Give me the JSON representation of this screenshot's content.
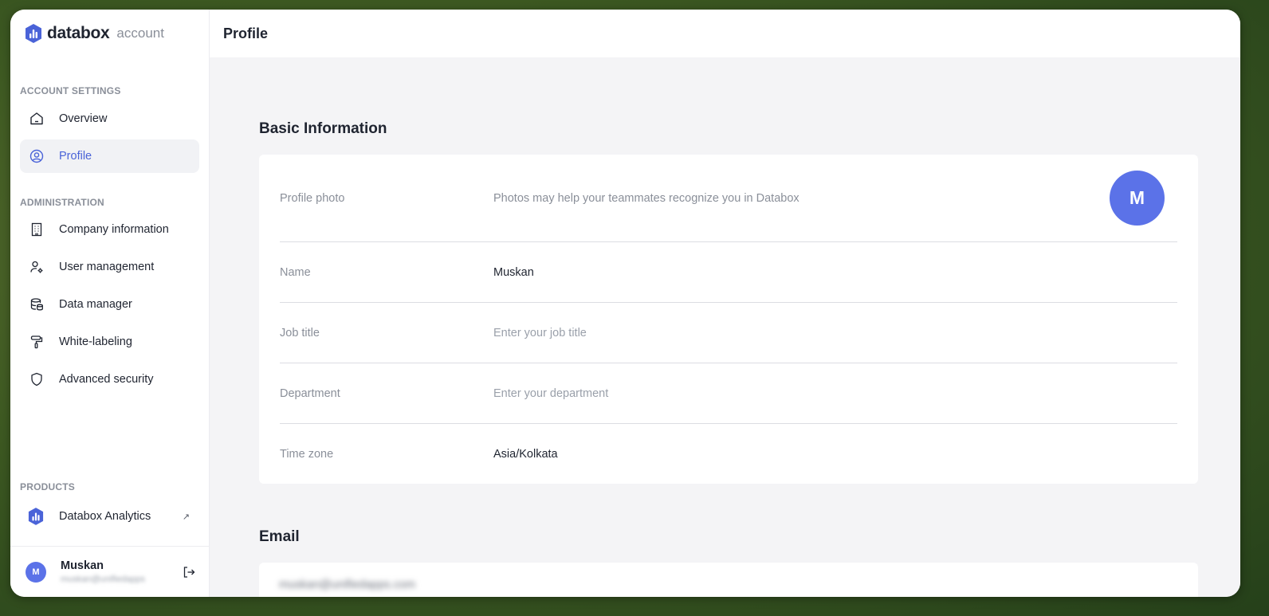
{
  "app": {
    "logo_word": "databox",
    "logo_sub": "account",
    "accent_color": "#5b72e8"
  },
  "header": {
    "title": "Profile"
  },
  "sidebar": {
    "sections": {
      "account_settings": "ACCOUNT SETTINGS",
      "administration": "ADMINISTRATION",
      "products": "PRODUCTS"
    },
    "items": [
      {
        "label": "Overview",
        "icon": "home-icon",
        "active": false
      },
      {
        "label": "Profile",
        "icon": "user-circle-icon",
        "active": true
      },
      {
        "label": "Company information",
        "icon": "building-icon",
        "active": false
      },
      {
        "label": "User management",
        "icon": "user-gear-icon",
        "active": false
      },
      {
        "label": "Data manager",
        "icon": "database-icon",
        "active": false
      },
      {
        "label": "White-labeling",
        "icon": "paint-roller-icon",
        "active": false
      },
      {
        "label": "Advanced security",
        "icon": "shield-icon",
        "active": false
      }
    ],
    "products": [
      {
        "label": "Databox Analytics",
        "icon": "databox-logo-icon",
        "external": true
      }
    ],
    "user": {
      "initial": "M",
      "name": "Muskan",
      "email": "muskan@unifiedapps"
    }
  },
  "main": {
    "basic_info": {
      "heading": "Basic Information",
      "profile_photo": {
        "label": "Profile photo",
        "hint": "Photos may help your teammates recognize you in Databox",
        "avatar_initial": "M"
      },
      "name": {
        "label": "Name",
        "value": "Muskan"
      },
      "job_title": {
        "label": "Job title",
        "placeholder": "Enter your job title"
      },
      "department": {
        "label": "Department",
        "placeholder": "Enter your department"
      },
      "time_zone": {
        "label": "Time zone",
        "value": "Asia/Kolkata"
      }
    },
    "email": {
      "heading": "Email",
      "value": "muskan@unifiedapps.com"
    }
  }
}
